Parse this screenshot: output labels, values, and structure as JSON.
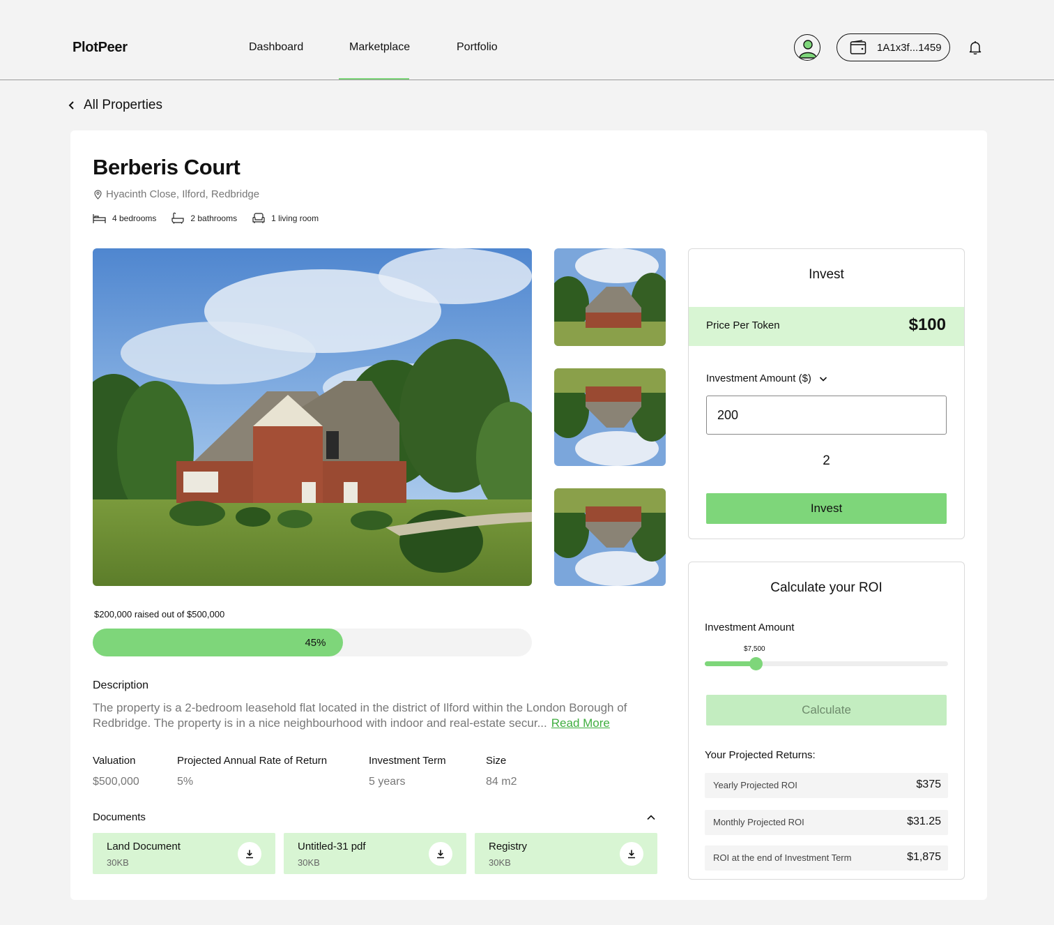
{
  "header": {
    "logo": "PlotPeer",
    "nav": [
      "Dashboard",
      "Marketplace",
      "Portfolio"
    ],
    "active_nav": "Marketplace",
    "wallet_address": "1A1x3f...1459"
  },
  "back_link": "All Properties",
  "property": {
    "title": "Berberis Court",
    "address": "Hyacinth Close, Ilford, Redbridge",
    "features": {
      "bedrooms": "4 bedrooms",
      "bathrooms": "2 bathrooms",
      "living": "1 living room"
    },
    "funding": {
      "raised_text": "$200,000 raised out of $500,000",
      "percent_label": "45%",
      "percent": 45
    },
    "description_heading": "Description",
    "description": "The property is a 2-bedroom leasehold flat located in the district of Ilford within the London Borough of Redbridge. The property is in a nice neighbourhood with indoor and real-estate secur...",
    "read_more": "Read More",
    "stats": {
      "valuation_label": "Valuation",
      "valuation_value": "$500,000",
      "return_label": "Projected Annual Rate of Return",
      "return_value": "5%",
      "term_label": "Investment Term",
      "term_value": "5 years",
      "size_label": "Size",
      "size_value": "84 m2"
    },
    "documents_heading": "Documents",
    "documents": [
      {
        "name": "Land Document",
        "size": "30KB"
      },
      {
        "name": "Untitled-31 pdf",
        "size": "30KB"
      },
      {
        "name": "Registry",
        "size": "30KB"
      }
    ]
  },
  "invest": {
    "title": "Invest",
    "price_label": "Price Per Token",
    "price_value": "$100",
    "amount_label": "Investment Amount ($)",
    "amount_value": "200",
    "tokens": "2",
    "button": "Invest"
  },
  "roi": {
    "title": "Calculate your ROI",
    "amount_label": "Investment Amount",
    "slider_value_label": "$7,500",
    "slider_fraction": 0.21,
    "button": "Calculate",
    "returns_heading": "Your Projected Returns:",
    "rows": [
      {
        "label": "Yearly Projected ROI",
        "value": "$375"
      },
      {
        "label": "Monthly Projected ROI",
        "value": "$31.25"
      },
      {
        "label": "ROI at the end of Investment Term",
        "value": "$1,875"
      }
    ]
  },
  "colors": {
    "accent": "#7ed67a",
    "accent_light": "#d8f5d3",
    "background": "#f3f3f3"
  },
  "icons": [
    "user-avatar-icon",
    "wallet-icon",
    "bell-icon",
    "chevron-left-icon",
    "location-pin-icon",
    "bed-icon",
    "bath-icon",
    "sofa-icon",
    "chevron-down-icon",
    "chevron-up-icon",
    "download-icon"
  ]
}
